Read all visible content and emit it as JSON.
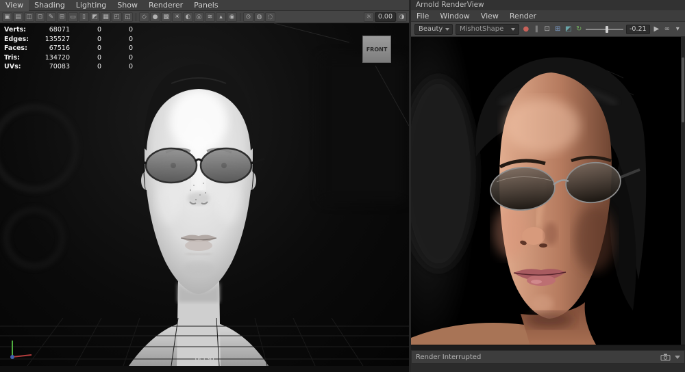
{
  "maya": {
    "menubar": {
      "items": [
        "View",
        "Shading",
        "Lighting",
        "Show",
        "Renderer",
        "Panels"
      ]
    },
    "toolbar": {
      "icons": [
        {
          "name": "camera-attributes-icon",
          "glyph": "▣"
        },
        {
          "name": "bookmarks-icon",
          "glyph": "▤"
        },
        {
          "name": "image-plane-icon",
          "glyph": "◫"
        },
        {
          "name": "pan-zoom-icon",
          "glyph": "⊡"
        },
        {
          "name": "grease-pencil-icon",
          "glyph": "✎"
        },
        {
          "name": "grid-icon",
          "glyph": "⊞"
        },
        {
          "name": "film-gate-icon",
          "glyph": "▭"
        },
        {
          "name": "resolution-gate-icon",
          "glyph": "▯"
        },
        {
          "name": "gate-mask-icon",
          "glyph": "◩"
        },
        {
          "name": "field-chart-icon",
          "glyph": "▦"
        },
        {
          "name": "safe-action-icon",
          "glyph": "◰"
        },
        {
          "name": "safe-title-icon",
          "glyph": "◱"
        },
        {
          "name": "wireframe-icon",
          "glyph": "◇"
        },
        {
          "name": "shaded-icon",
          "glyph": "●"
        },
        {
          "name": "textured-icon",
          "glyph": "▩"
        },
        {
          "name": "lights-icon",
          "glyph": "☀"
        },
        {
          "name": "shadows-icon",
          "glyph": "◐"
        },
        {
          "name": "ao-icon",
          "glyph": "◎"
        },
        {
          "name": "motion-blur-icon",
          "glyph": "≋"
        },
        {
          "name": "antialias-icon",
          "glyph": "▴"
        },
        {
          "name": "dof-icon",
          "glyph": "◉"
        },
        {
          "name": "isolate-select-icon",
          "glyph": "⊙"
        },
        {
          "name": "xray-icon",
          "glyph": "◍"
        },
        {
          "name": "default-material-icon",
          "glyph": "◌"
        },
        {
          "name": "exposure-icon",
          "glyph": "☼"
        },
        {
          "name": "gamma-icon",
          "glyph": "◑"
        }
      ],
      "exposure_value": "0.00"
    },
    "hud": {
      "rows": [
        {
          "label": "Verts:",
          "v1": "68071",
          "v2": "0",
          "v3": "0"
        },
        {
          "label": "Edges:",
          "v1": "135527",
          "v2": "0",
          "v3": "0"
        },
        {
          "label": "Faces:",
          "v1": "67516",
          "v2": "0",
          "v3": "0"
        },
        {
          "label": "Tris:",
          "v1": "134720",
          "v2": "0",
          "v3": "0"
        },
        {
          "label": "UVs:",
          "v1": "70083",
          "v2": "0",
          "v3": "0"
        }
      ]
    },
    "viewport": {
      "viewcube_label": "FRONT",
      "camera_label": "persp"
    }
  },
  "arnold": {
    "title": "Arnold RenderView",
    "menubar": {
      "items": [
        "File",
        "Window",
        "View",
        "Render"
      ]
    },
    "toolbar": {
      "aov": "Beauty",
      "camera": "MishotShape",
      "exposure_value": "-0.21",
      "icons": [
        {
          "name": "render-icon",
          "glyph": "●"
        },
        {
          "name": "pause-icon",
          "glyph": "‖"
        },
        {
          "name": "crop-region-icon",
          "glyph": "⊡"
        },
        {
          "name": "aov-grid-icon",
          "glyph": "⊞"
        },
        {
          "name": "debug-shading-icon",
          "glyph": "◩"
        },
        {
          "name": "refresh-render-icon",
          "glyph": "↻"
        },
        {
          "name": "play-icon",
          "glyph": "▶"
        },
        {
          "name": "loop-icon",
          "glyph": "∞"
        },
        {
          "name": "menu-chevron-icon",
          "glyph": "▾"
        }
      ]
    },
    "statusbar": {
      "status": "Render Interrupted"
    }
  },
  "colors": {
    "panel_bg": "#454545",
    "viewport_bg": "#0b0b0b",
    "accent_green": "#74b25e",
    "hud_text": "#f0f0f0"
  }
}
